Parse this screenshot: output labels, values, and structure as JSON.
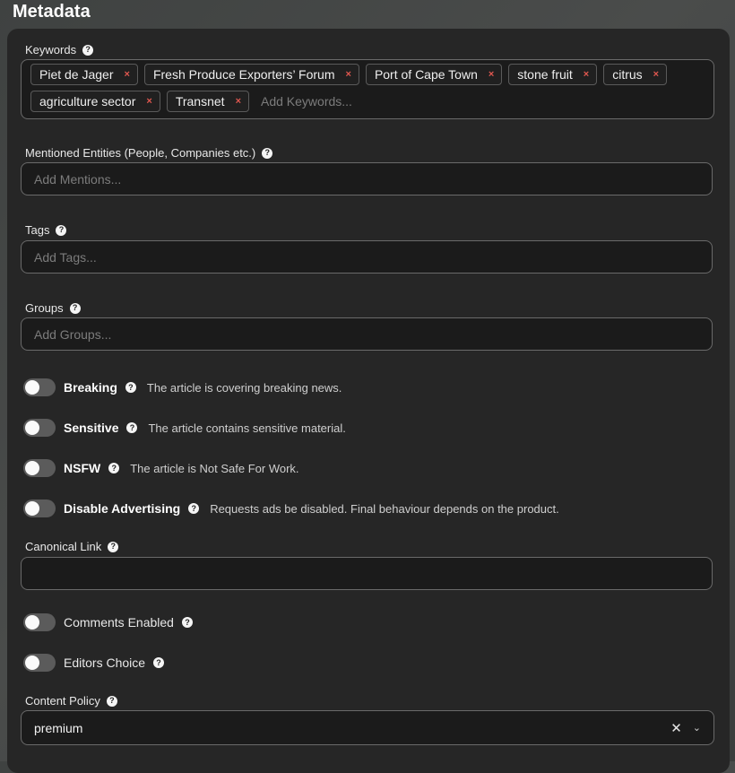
{
  "page": {
    "title": "Metadata"
  },
  "keywords": {
    "label": "Keywords",
    "chips": [
      "Piet de Jager",
      "Fresh Produce Exporters’ Forum",
      "Port of Cape Town",
      "stone fruit",
      "citrus",
      "agriculture sector",
      "Transnet"
    ],
    "placeholder": "Add Keywords..."
  },
  "mentions": {
    "label": "Mentioned Entities (People, Companies etc.)",
    "placeholder": "Add Mentions..."
  },
  "tags": {
    "label": "Tags",
    "placeholder": "Add Tags..."
  },
  "groups": {
    "label": "Groups",
    "placeholder": "Add Groups..."
  },
  "toggles": {
    "breaking": {
      "label": "Breaking",
      "description": "The article is covering breaking news.",
      "on": false
    },
    "sensitive": {
      "label": "Sensitive",
      "description": "The article contains sensitive material.",
      "on": false
    },
    "nsfw": {
      "label": "NSFW",
      "description": "The article is Not Safe For Work.",
      "on": false
    },
    "disable_ads": {
      "label": "Disable Advertising",
      "description": "Requests ads be disabled. Final behaviour depends on the product.",
      "on": false
    },
    "comments": {
      "label": "Comments Enabled",
      "on": false
    },
    "editors_choice": {
      "label": "Editors Choice",
      "on": false
    }
  },
  "canonical": {
    "label": "Canonical Link",
    "value": ""
  },
  "content_policy": {
    "label": "Content Policy",
    "value": "premium"
  },
  "icons": {
    "help": "?",
    "chip_remove": "×",
    "select_clear": "✕",
    "select_chevron": "⌄"
  },
  "colors": {
    "remove_x": "#e0574f",
    "panel": "#262626",
    "toggle_off": "#5b5b5b"
  }
}
